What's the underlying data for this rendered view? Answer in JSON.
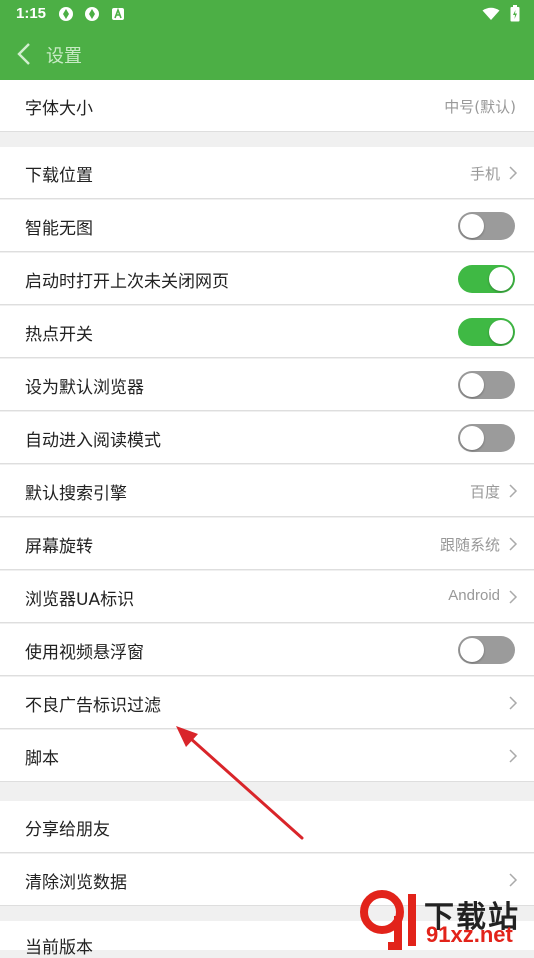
{
  "status_bar": {
    "time": "1:15"
  },
  "header": {
    "title": "设置"
  },
  "settings": {
    "font_size": {
      "label": "字体大小",
      "value": "中号(默认)"
    },
    "download_location": {
      "label": "下载位置",
      "value": "手机"
    },
    "smart_no_image": {
      "label": "智能无图",
      "state": "off"
    },
    "restore_pages": {
      "label": "启动时打开上次未关闭网页",
      "state": "on"
    },
    "hotspot": {
      "label": "热点开关",
      "state": "on"
    },
    "default_browser": {
      "label": "设为默认浏览器",
      "state": "off"
    },
    "auto_reading_mode": {
      "label": "自动进入阅读模式",
      "state": "off"
    },
    "search_engine": {
      "label": "默认搜索引擎",
      "value": "百度"
    },
    "screen_rotation": {
      "label": "屏幕旋转",
      "value": "跟随系统"
    },
    "browser_ua": {
      "label": "浏览器UA标识",
      "value": "Android"
    },
    "floating_video": {
      "label": "使用视频悬浮窗",
      "state": "off"
    },
    "ad_filter": {
      "label": "不良广告标识过滤"
    },
    "script": {
      "label": "脚本"
    },
    "share_friends": {
      "label": "分享给朋友"
    },
    "clear_data": {
      "label": "清除浏览数据"
    },
    "current_version": {
      "label": "当前版本"
    }
  },
  "watermark": {
    "text_top": "下载站",
    "text_bottom": "91xz.net"
  },
  "colors": {
    "accent": "#4caf45",
    "toggle_on": "#3fb944",
    "toggle_off": "#9b9b9b",
    "annotation_arrow": "#d9252a"
  }
}
